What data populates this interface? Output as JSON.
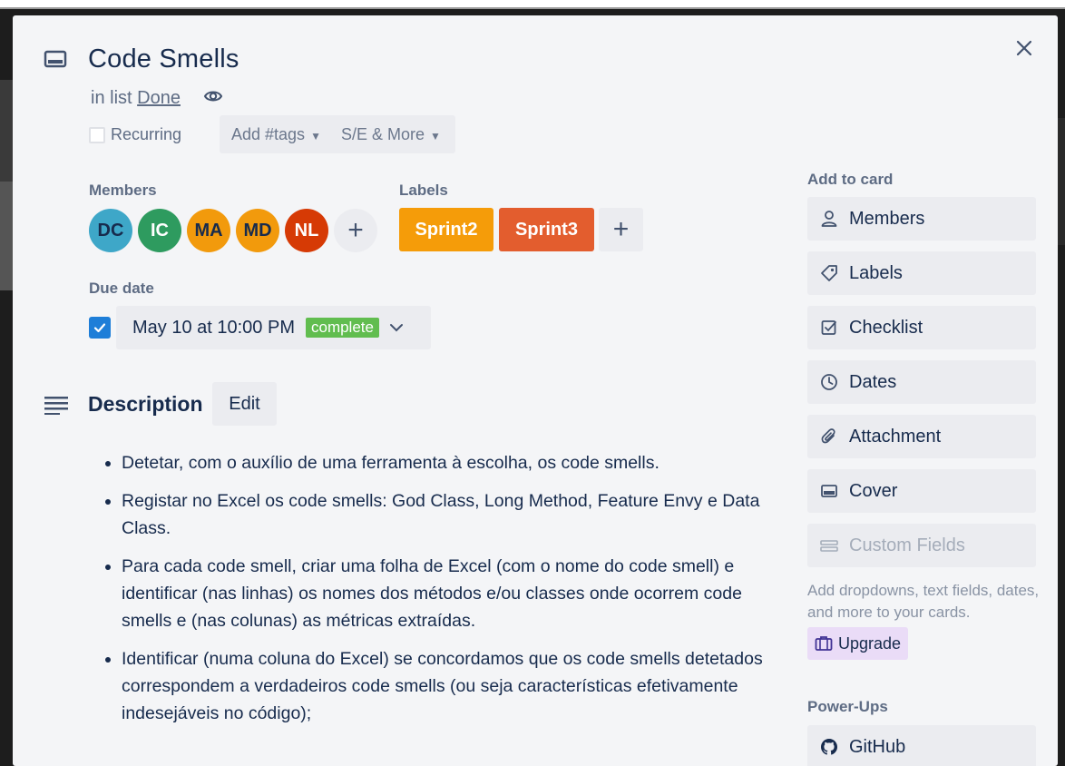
{
  "card": {
    "title": "Code Smells",
    "in_list_prefix": "in list",
    "list_name": "Done"
  },
  "options": {
    "recurring_label": "Recurring",
    "add_tags_label": "Add #tags",
    "se_more_label": "S/E & More"
  },
  "members": {
    "heading": "Members",
    "items": [
      {
        "initials": "DC",
        "color": "#3ea7c8"
      },
      {
        "initials": "IC",
        "color": "#2e9b5f"
      },
      {
        "initials": "MA",
        "color": "#f29a0c"
      },
      {
        "initials": "MD",
        "color": "#f29a0c"
      },
      {
        "initials": "NL",
        "color": "#d63a05"
      }
    ],
    "add_symbol": "+"
  },
  "labels": {
    "heading": "Labels",
    "items": [
      {
        "name": "Sprint2",
        "color": "#f59c09"
      },
      {
        "name": "Sprint3",
        "color": "#e35d2e"
      }
    ],
    "add_symbol": "+"
  },
  "due_date": {
    "heading": "Due date",
    "value": "May 10 at 10:00 PM",
    "status": "complete",
    "checked": true
  },
  "description": {
    "heading": "Description",
    "edit_label": "Edit",
    "items": [
      "Detetar, com o auxílio de uma ferramenta à escolha, os code smells.",
      "Registar no Excel os code smells: God Class, Long Method, Feature Envy e Data Class.",
      "Para cada code smell, criar uma folha de Excel (com o nome do code smell) e identificar (nas linhas) os nomes dos métodos e/ou classes onde ocorrem code smells e (nas colunas) as métricas extraídas.",
      "Identificar (numa coluna do Excel) se concordamos que os code smells detetados correspondem a verdadeiros code smells (ou seja características efetivamente indesejáveis no código);"
    ]
  },
  "sidebar": {
    "add_to_card_heading": "Add to card",
    "buttons": [
      {
        "label": "Members",
        "icon": "person-icon"
      },
      {
        "label": "Labels",
        "icon": "tag-icon"
      },
      {
        "label": "Checklist",
        "icon": "checklist-icon"
      },
      {
        "label": "Dates",
        "icon": "clock-icon"
      },
      {
        "label": "Attachment",
        "icon": "paperclip-icon"
      },
      {
        "label": "Cover",
        "icon": "cover-icon"
      },
      {
        "label": "Custom Fields",
        "icon": "custom-fields-icon"
      }
    ],
    "custom_fields_help": "Add dropdowns, text fields, dates, and more to your cards.",
    "upgrade_label": "Upgrade",
    "power_ups_heading": "Power-Ups",
    "power_ups": [
      {
        "label": "GitHub",
        "icon": "github-icon"
      }
    ]
  },
  "colors": {
    "modal_bg": "#f4f5f7",
    "button_bg": "#ebecf0",
    "accent_blue": "#1e7ed8",
    "complete_green": "#61bd4f"
  }
}
